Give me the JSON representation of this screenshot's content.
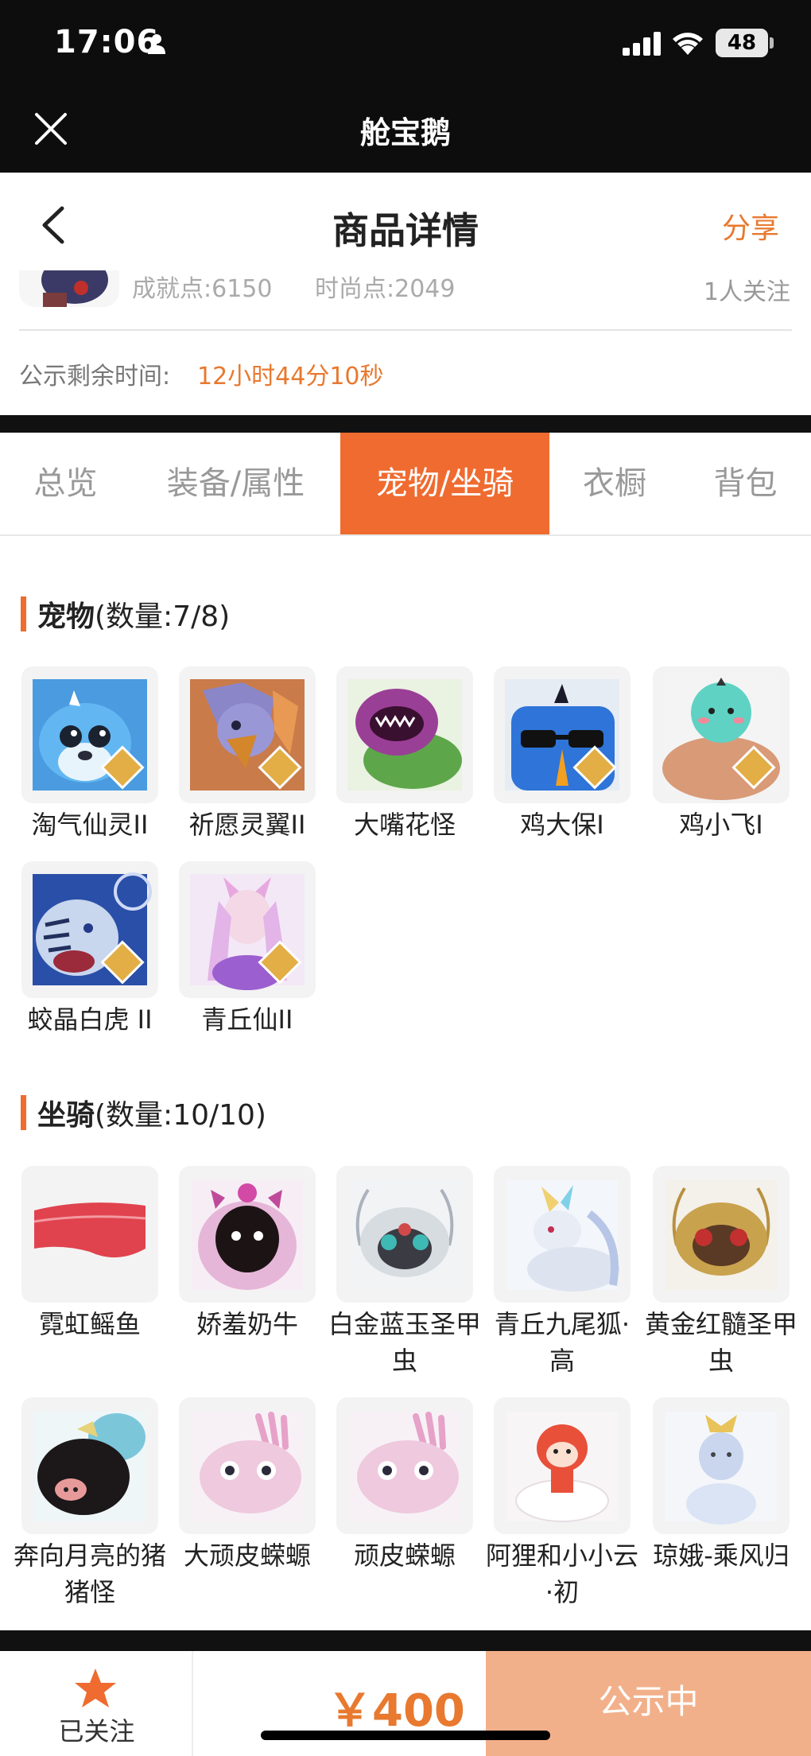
{
  "status_bar": {
    "time": "17:06",
    "battery": "48"
  },
  "app": {
    "title": "舱宝鹅"
  },
  "nav": {
    "title": "商品详情",
    "share": "分享"
  },
  "header": {
    "achievement": "成就点:6150",
    "fashion": "时尚点:2049",
    "followers": "1人关注",
    "countdown_label": "公示剩余时间:",
    "countdown_value": "12小时44分10秒"
  },
  "tabs": [
    {
      "label": "总览"
    },
    {
      "label": "装备/属性"
    },
    {
      "label": "宠物/坐骑",
      "active": true
    },
    {
      "label": "衣橱"
    },
    {
      "label": "背包"
    }
  ],
  "pets": {
    "title": "宠物",
    "count": "(数量:7/8)",
    "items": [
      {
        "name": "淘气仙灵II",
        "badge": "II",
        "icon": "blue-dog-pet"
      },
      {
        "name": "祈愿灵翼II",
        "badge": "II",
        "icon": "griffin-pet"
      },
      {
        "name": "大嘴花怪",
        "icon": "flower-monster-pet"
      },
      {
        "name": "鸡大保I",
        "badge": "I",
        "icon": "blue-bird-sunglasses-pet"
      },
      {
        "name": "鸡小飞I",
        "badge": "I",
        "icon": "muscle-chick-pet"
      },
      {
        "name": "蛟晶白虎 II",
        "badge": "II",
        "icon": "white-tiger-pet"
      },
      {
        "name": "青丘仙II",
        "badge": "II",
        "icon": "fox-fairy-pet"
      }
    ]
  },
  "mounts": {
    "title": "坐骑",
    "count": "(数量:10/10)",
    "items": [
      {
        "name": "霓虹鳐鱼",
        "icon": "neon-ray-mount"
      },
      {
        "name": "娇羞奶牛",
        "icon": "shy-cow-mount"
      },
      {
        "name": "白金蓝玉圣甲虫",
        "icon": "platinum-beetle-mount"
      },
      {
        "name": "青丘九尾狐·高",
        "icon": "nine-tail-fox-mount"
      },
      {
        "name": "黄金红髓圣甲虫",
        "icon": "gold-beetle-mount"
      },
      {
        "name": "奔向月亮的猪猪怪",
        "icon": "moon-pig-mount"
      },
      {
        "name": "大顽皮蝾螈",
        "icon": "big-axolotl-mount"
      },
      {
        "name": "顽皮蝾螈",
        "icon": "axolotl-mount"
      },
      {
        "name": "阿狸和小小云·初",
        "icon": "ali-cloud-mount"
      },
      {
        "name": "琼娥-乘风归",
        "icon": "goddess-mount"
      }
    ]
  },
  "bottom": {
    "follow_label": "已关注",
    "price": "￥400",
    "status_button": "公示中"
  },
  "colors": {
    "accent": "#ef6b30",
    "price": "#e8792f",
    "status_button": "#f2b08a"
  }
}
